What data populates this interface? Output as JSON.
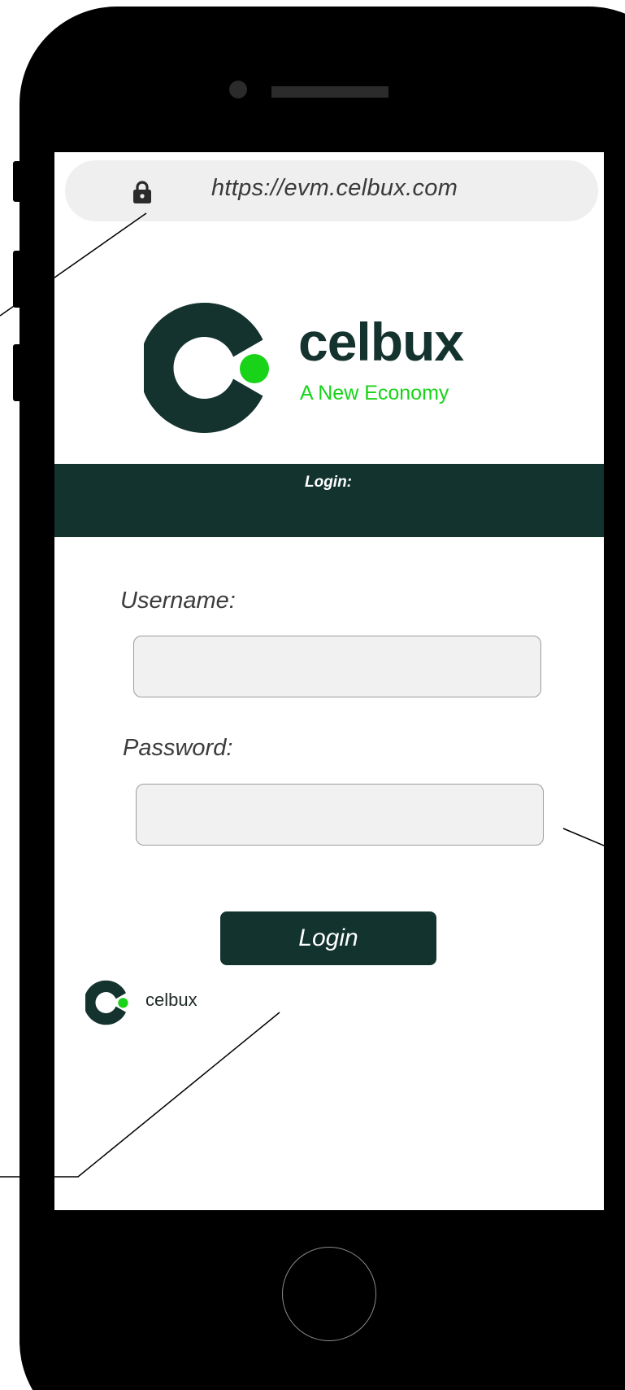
{
  "browser": {
    "url": "https://evm.celbux.com",
    "lock_icon": "lock-icon"
  },
  "brand": {
    "name": "celbux",
    "tagline": "A New Economy",
    "logo_icon": "celbux-c-logo-icon",
    "colors": {
      "dark": "#14332e",
      "accent": "#18d318"
    }
  },
  "banner": {
    "label": "Login:"
  },
  "form": {
    "username_label": "Username:",
    "username_value": "",
    "password_label": "Password:",
    "password_value": "",
    "submit_label": "Login"
  },
  "footer_logo": {
    "name": "celbux"
  }
}
